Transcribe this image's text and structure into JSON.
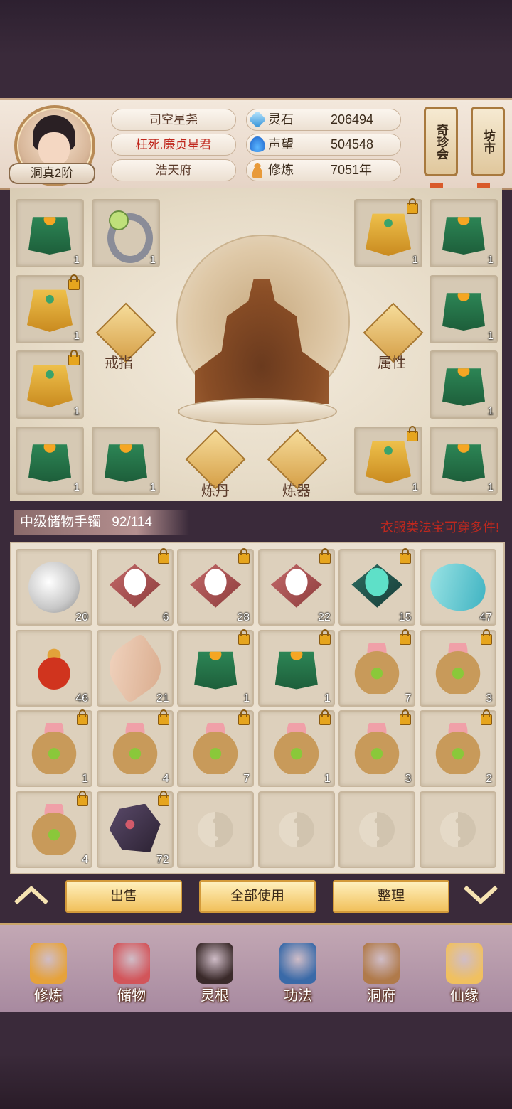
{
  "player": {
    "rank": "洞真2阶",
    "title": "司空星尧",
    "honor": "枉死.廉贞星君",
    "residence": "浩天府"
  },
  "stats": [
    {
      "label": "灵石",
      "value": "206494",
      "icon": "spirit-stone-icon"
    },
    {
      "label": "声望",
      "value": "504548",
      "icon": "reputation-flame-icon"
    },
    {
      "label": "修炼",
      "value": "7051年",
      "icon": "meditation-icon"
    }
  ],
  "shops": {
    "treasure": "奇珍会",
    "market": "坊市"
  },
  "equipment": {
    "ring_label": "戒指",
    "attr_label": "属性",
    "alchemy_label": "炼丹",
    "forge_label": "炼器",
    "slots": [
      {
        "item": "green-robe",
        "qty": "1",
        "locked": false
      },
      {
        "item": "ring",
        "qty": "1",
        "locked": false
      },
      {
        "item": "gold-robe",
        "qty": "1",
        "locked": true
      },
      {
        "item": "green-robe",
        "qty": "1",
        "locked": false
      },
      {
        "item": "gold-robe",
        "qty": "1",
        "locked": true
      },
      {
        "item": "green-robe",
        "qty": "1",
        "locked": false
      },
      {
        "item": "gold-robe",
        "qty": "1",
        "locked": true
      },
      {
        "item": "green-robe",
        "qty": "1",
        "locked": false
      },
      {
        "item": "green-robe",
        "qty": "1",
        "locked": false
      },
      {
        "item": "green-robe",
        "qty": "1",
        "locked": false
      },
      {
        "item": "gold-robe",
        "qty": "1",
        "locked": true
      },
      {
        "item": "green-robe",
        "qty": "1",
        "locked": false
      }
    ]
  },
  "bag": {
    "title": "中级储物手镯",
    "capacity": "92/114",
    "hint": "衣服类法宝可穿多件!",
    "items": [
      {
        "item": "silver-orb",
        "qty": "20",
        "locked": false
      },
      {
        "item": "rice-pile",
        "qty": "6",
        "locked": true
      },
      {
        "item": "rice-pile",
        "qty": "28",
        "locked": true
      },
      {
        "item": "rice-pile",
        "qty": "22",
        "locked": true
      },
      {
        "item": "jade-pile",
        "qty": "15",
        "locked": true
      },
      {
        "item": "gourd",
        "qty": "47",
        "locked": false
      },
      {
        "item": "teapot",
        "qty": "46",
        "locked": false
      },
      {
        "item": "scroll",
        "qty": "21",
        "locked": false
      },
      {
        "item": "green-robe",
        "qty": "1",
        "locked": true
      },
      {
        "item": "green-robe",
        "qty": "1",
        "locked": true
      },
      {
        "item": "herb-sack",
        "qty": "7",
        "locked": true
      },
      {
        "item": "herb-sack",
        "qty": "3",
        "locked": true
      },
      {
        "item": "herb-sack",
        "qty": "1",
        "locked": true
      },
      {
        "item": "herb-sack",
        "qty": "4",
        "locked": true
      },
      {
        "item": "herb-sack",
        "qty": "7",
        "locked": true
      },
      {
        "item": "herb-sack",
        "qty": "1",
        "locked": true
      },
      {
        "item": "herb-sack",
        "qty": "3",
        "locked": true
      },
      {
        "item": "herb-sack",
        "qty": "2",
        "locked": true
      },
      {
        "item": "herb-sack",
        "qty": "4",
        "locked": true
      },
      {
        "item": "ore",
        "qty": "72",
        "locked": true
      },
      {
        "item": "empty",
        "qty": "",
        "locked": false
      },
      {
        "item": "empty",
        "qty": "",
        "locked": false
      },
      {
        "item": "empty",
        "qty": "",
        "locked": false
      },
      {
        "item": "empty",
        "qty": "",
        "locked": false
      }
    ]
  },
  "actions": {
    "sell": "出售",
    "use_all": "全部使用",
    "sort": "整理"
  },
  "nav": [
    {
      "label": "修炼",
      "icon": "cultivate-icon"
    },
    {
      "label": "储物",
      "icon": "storage-bag-icon"
    },
    {
      "label": "灵根",
      "icon": "spirit-root-icon"
    },
    {
      "label": "功法",
      "icon": "technique-book-icon"
    },
    {
      "label": "洞府",
      "icon": "cave-dwelling-icon"
    },
    {
      "label": "仙缘",
      "icon": "immortal-fate-icon"
    }
  ],
  "colors": {
    "accent_gold": "#f1c05a",
    "hint_red": "#c0281e",
    "panel": "#ebe1d1"
  }
}
